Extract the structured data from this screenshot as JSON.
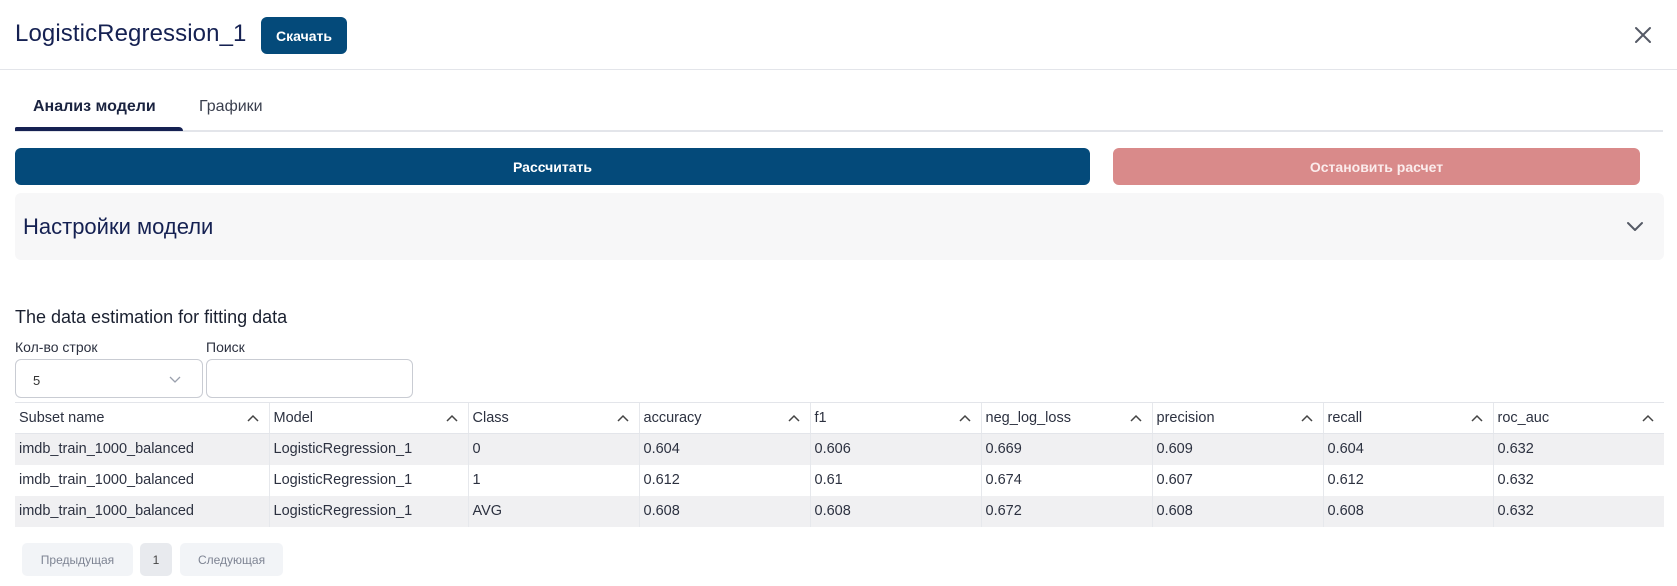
{
  "header": {
    "title": "LogisticRegression_1",
    "download_label": "Скачать",
    "close_icon": "close-icon"
  },
  "tabs": [
    {
      "label": "Анализ модели",
      "active": true
    },
    {
      "label": "Графики",
      "active": false
    }
  ],
  "actions": {
    "calculate_label": "Рассчитать",
    "stop_label": "Остановить расчет"
  },
  "settings": {
    "title": "Настройки модели",
    "chevron_icon": "chevron-down-icon"
  },
  "estimation": {
    "title": "The data estimation for fitting data",
    "rows_label": "Кол-во строк",
    "rows_value": "5",
    "search_label": "Поиск",
    "search_value": "",
    "columns": [
      "Subset name",
      "Model",
      "Class",
      "accuracy",
      "f1",
      "neg_log_loss",
      "precision",
      "recall",
      "roc_auc"
    ],
    "rows": [
      [
        "imdb_train_1000_balanced",
        "LogisticRegression_1",
        "0",
        "0.604",
        "0.606",
        "0.669",
        "0.609",
        "0.604",
        "0.632"
      ],
      [
        "imdb_train_1000_balanced",
        "LogisticRegression_1",
        "1",
        "0.612",
        "0.61",
        "0.674",
        "0.607",
        "0.612",
        "0.632"
      ],
      [
        "imdb_train_1000_balanced",
        "LogisticRegression_1",
        "AVG",
        "0.608",
        "0.608",
        "0.672",
        "0.608",
        "0.608",
        "0.632"
      ]
    ]
  },
  "pagination": {
    "prev_label": "Предыдущая",
    "page": "1",
    "next_label": "Следующая"
  },
  "colors": {
    "primary": "#044a7a",
    "danger_disabled": "#d98a8a",
    "title": "#152152",
    "row_alt": "#f0f0f2"
  }
}
